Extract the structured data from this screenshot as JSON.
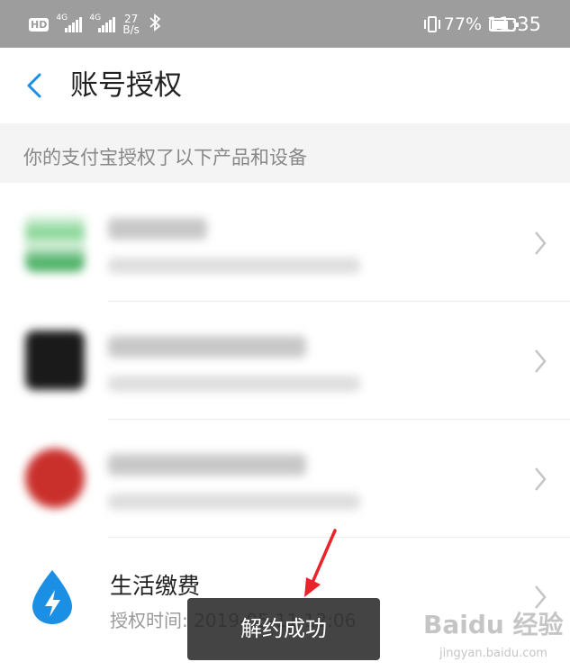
{
  "status_bar": {
    "hd_label": "HD",
    "network1": "4G",
    "network2": "4G",
    "speed_value": "27",
    "speed_unit": "B/s",
    "battery": "77%",
    "time": "11:35"
  },
  "header": {
    "title": "账号授权"
  },
  "section": {
    "description": "你的支付宝授权了以下产品和设备"
  },
  "items": [
    {
      "name": "",
      "subtitle": "",
      "blurred": true,
      "icon": "app-icon-green"
    },
    {
      "name": "",
      "subtitle": "",
      "blurred": true,
      "icon": "app-icon-dark"
    },
    {
      "name": "",
      "subtitle": "",
      "blurred": true,
      "icon": "app-icon-red"
    },
    {
      "name": "生活缴费",
      "subtitle": "授权时间: 2019-05-11 12:06",
      "blurred": false,
      "icon": "water-drop-lightning-icon"
    }
  ],
  "toast": {
    "message": "解约成功"
  },
  "watermark": {
    "brand": "Baidu 经验",
    "url": "jingyan.baidu.com"
  },
  "colors": {
    "status_bar_bg": "#9d9d9d",
    "accent_blue": "#1a8fe3",
    "toast_bg": "#232323",
    "annotation_red": "#e8232a"
  }
}
